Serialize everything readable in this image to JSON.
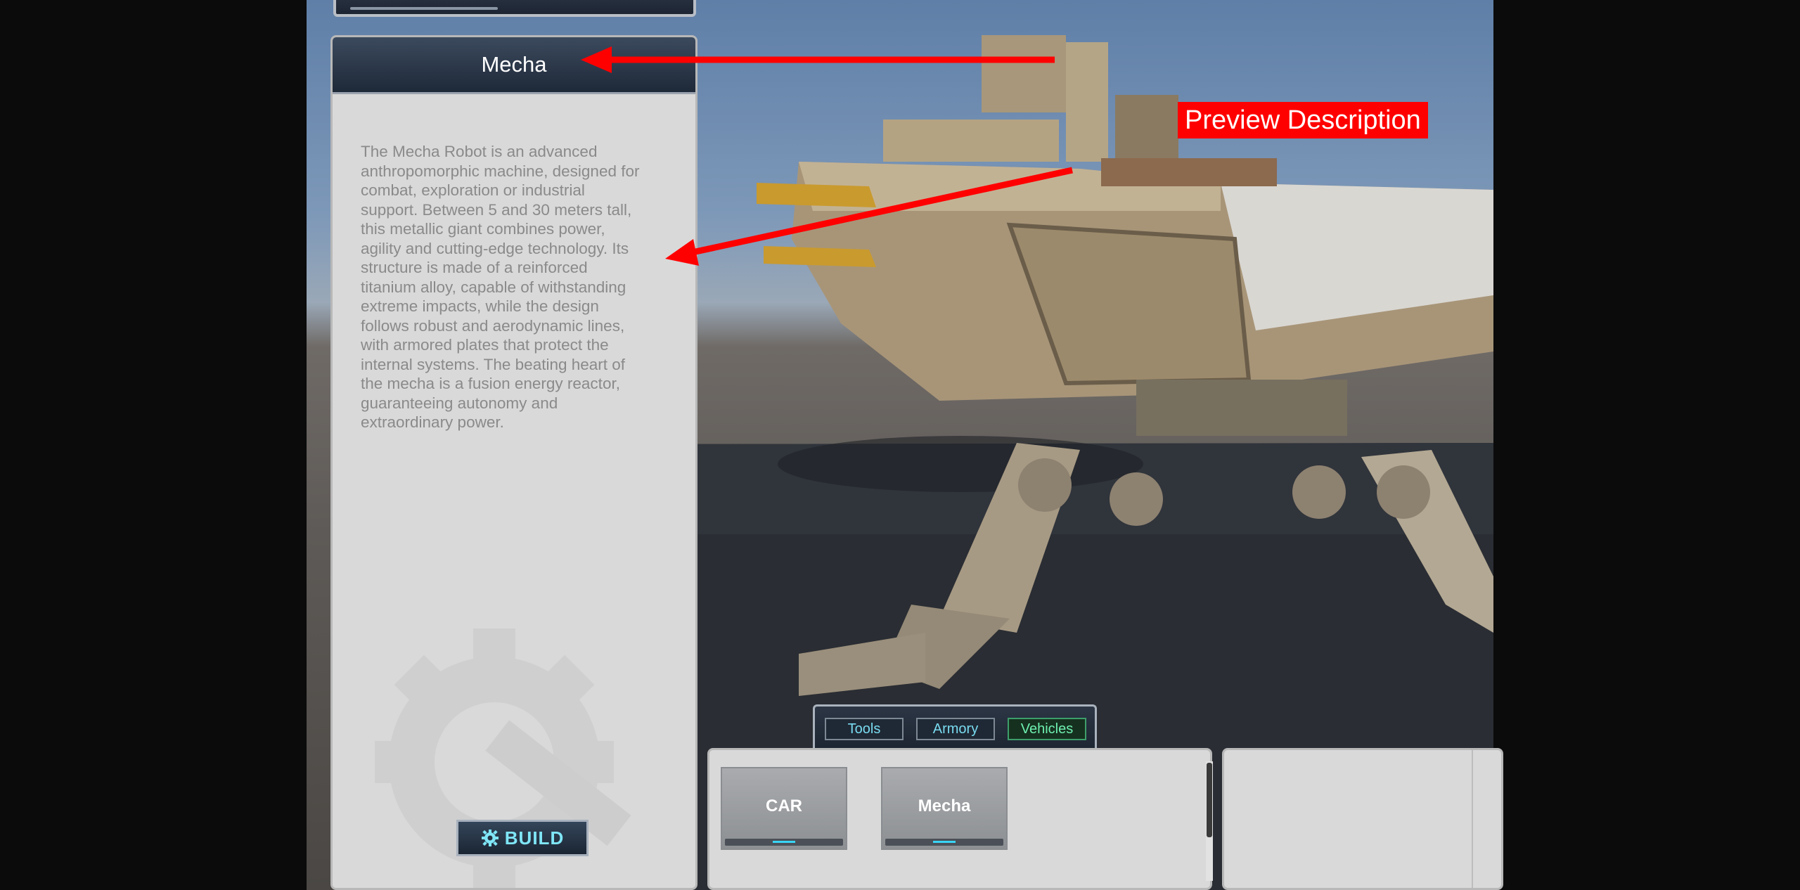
{
  "panel": {
    "title": "Mecha",
    "description": "The Mecha Robot is an advanced\nanthropomorphic machine, designed for\ncombat, exploration or industrial\nsupport. Between 5 and 30 meters tall,\nthis metallic giant combines power,\nagility and cutting-edge technology.  Its\nstructure is made of a reinforced\ntitanium alloy, capable of withstanding\nextreme impacts, while the design\nfollows robust and aerodynamic lines,\nwith armored plates that protect the\ninternal systems. The beating heart of\nthe mecha is a fusion energy reactor,\nguaranteeing autonomy and\nextraordinary power.",
    "build_label": "BUILD"
  },
  "categories": [
    {
      "label": "Tools",
      "active": false
    },
    {
      "label": "Armory",
      "active": false
    },
    {
      "label": "Vehicles",
      "active": true
    }
  ],
  "items": [
    {
      "label": "CAR"
    },
    {
      "label": "Mecha"
    }
  ],
  "annotation": {
    "label": "Preview Description",
    "color": "#ff0000"
  },
  "colors": {
    "header_bg": "#2a3545",
    "accent_cyan": "#3ad4f4",
    "active_tab": "#6ef0b0",
    "panel_bg": "#d9d9d9"
  }
}
